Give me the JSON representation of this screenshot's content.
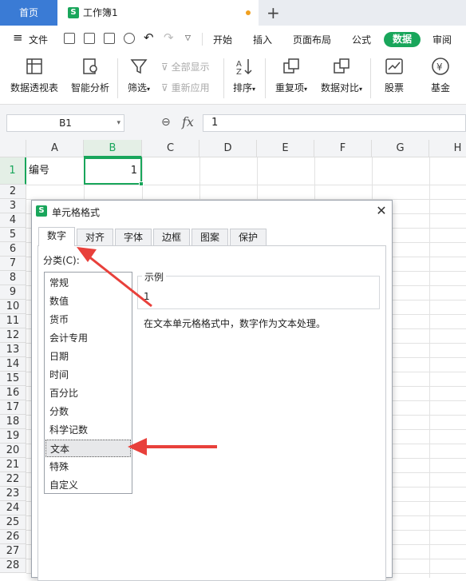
{
  "window": {
    "tabs": [
      {
        "label": "首页"
      },
      {
        "label": "工作簿1"
      }
    ],
    "new_tab_symbol": "+"
  },
  "menu": {
    "file_label": "文件",
    "tabs": [
      "开始",
      "插入",
      "页面布局",
      "公式",
      "数据",
      "审阅"
    ],
    "active_tab": "数据"
  },
  "ribbon": {
    "pivot": "数据透视表",
    "smart": "智能分析",
    "filter": "筛选",
    "show_all": "全部显示",
    "reapply": "重新应用",
    "sort": "排序",
    "duplicates": "重复项",
    "compare": "数据对比",
    "stock": "股票",
    "fund": "基金"
  },
  "formula_bar": {
    "name_box": "B1",
    "fx_label": "fx",
    "value": "1"
  },
  "sheet": {
    "columns": [
      "A",
      "B",
      "C",
      "D",
      "E",
      "F",
      "G",
      "H"
    ],
    "selected_column": "B",
    "rows": [
      "1",
      "2",
      "3",
      "4",
      "5",
      "6",
      "7",
      "8",
      "9",
      "10",
      "11",
      "12",
      "13",
      "14",
      "15",
      "16",
      "17",
      "18",
      "19",
      "20",
      "21",
      "22",
      "23",
      "24",
      "25",
      "26",
      "27",
      "28"
    ],
    "cells": {
      "A1": "编号",
      "B1": "1"
    }
  },
  "dialog": {
    "title": "单元格格式",
    "tabs": [
      "数字",
      "对齐",
      "字体",
      "边框",
      "图案",
      "保护"
    ],
    "active_tab": "数字",
    "category_label": "分类(C):",
    "categories": [
      "常规",
      "数值",
      "货币",
      "会计专用",
      "日期",
      "时间",
      "百分比",
      "分数",
      "科学记数",
      "文本",
      "特殊",
      "自定义"
    ],
    "selected_category": "文本",
    "sample_label": "示例",
    "sample_value": "1",
    "description": "在文本单元格格式中，数字作为文本处理。"
  },
  "colors": {
    "accent": "#19a65b",
    "home_tab": "#3a7bd5",
    "arrow": "#e8403b"
  }
}
